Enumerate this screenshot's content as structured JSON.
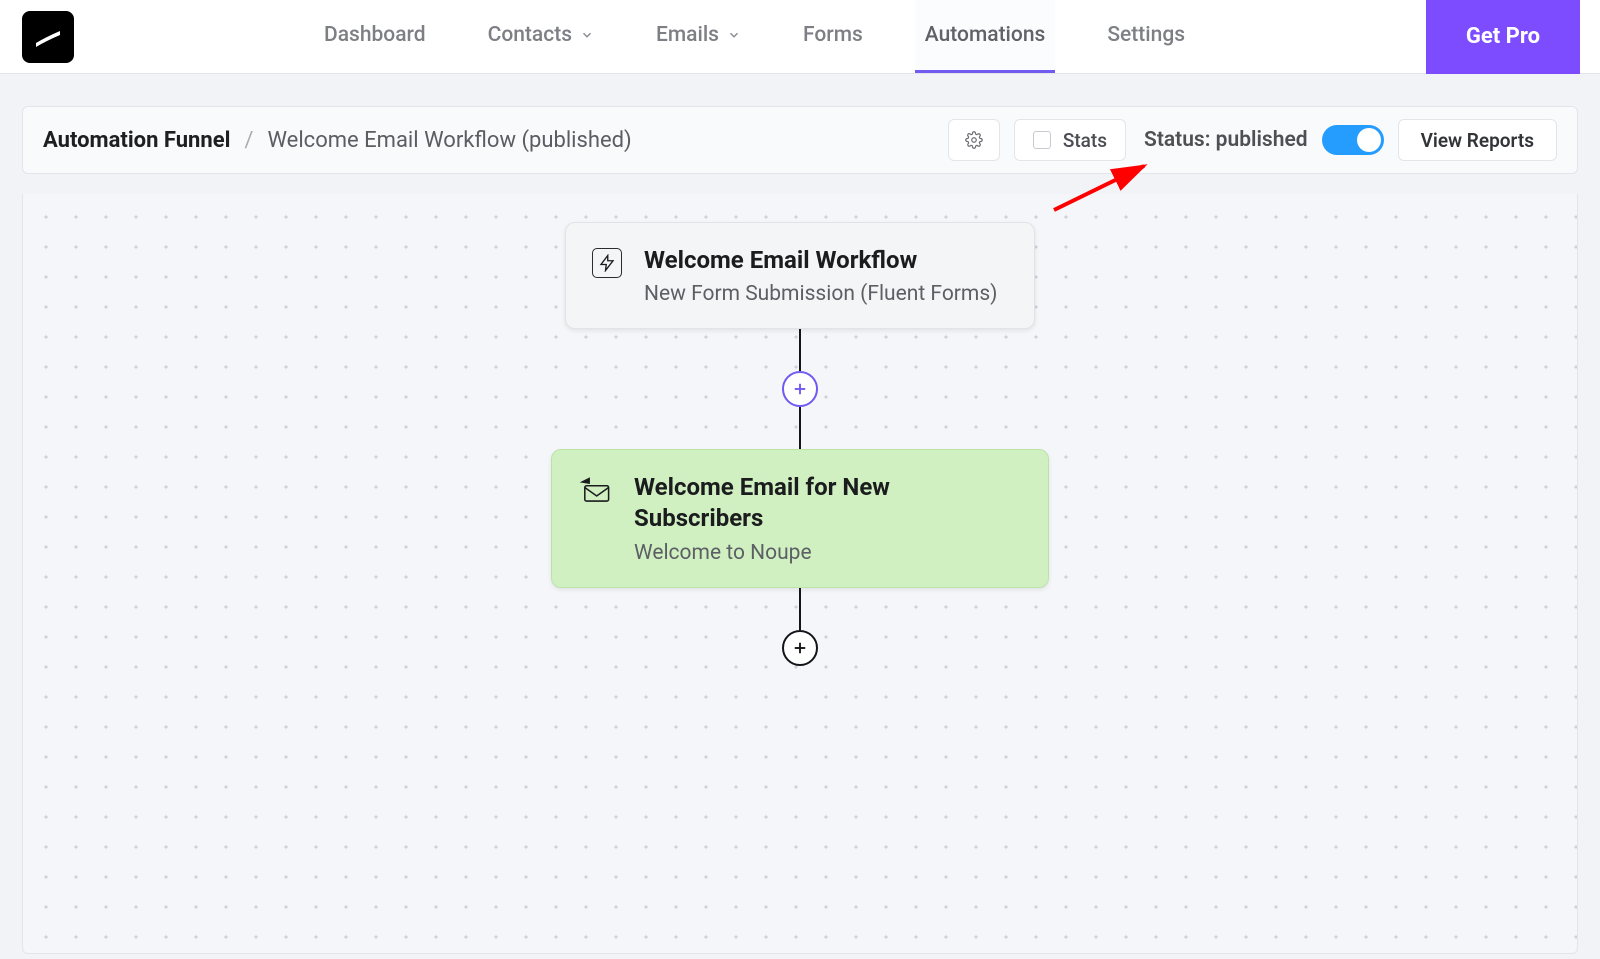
{
  "nav": {
    "items": [
      {
        "label": "Dashboard",
        "has_dropdown": false
      },
      {
        "label": "Contacts",
        "has_dropdown": true
      },
      {
        "label": "Emails",
        "has_dropdown": true
      },
      {
        "label": "Forms",
        "has_dropdown": false
      },
      {
        "label": "Automations",
        "has_dropdown": false,
        "active": true
      },
      {
        "label": "Settings",
        "has_dropdown": false
      }
    ],
    "cta_label": "Get Pro"
  },
  "header": {
    "breadcrumb_root": "Automation Funnel",
    "breadcrumb_separator": "/",
    "breadcrumb_leaf": "Welcome Email Workflow (published)",
    "stats_label": "Stats",
    "status_label": "Status: published",
    "status_on": true,
    "view_reports_label": "View Reports"
  },
  "flow": {
    "start": {
      "title": "Welcome Email Workflow",
      "subtitle": "New Form Submission (Fluent Forms)",
      "icon": "lightning-icon"
    },
    "action": {
      "title": "Welcome Email for New Subscribers",
      "subtitle": "Welcome to Noupe",
      "icon": "send-mail-icon"
    }
  },
  "colors": {
    "accent": "#705af2",
    "cta": "#7d4cff",
    "toggle_on": "#259dff",
    "action_node_bg": "#d1f0c2"
  }
}
